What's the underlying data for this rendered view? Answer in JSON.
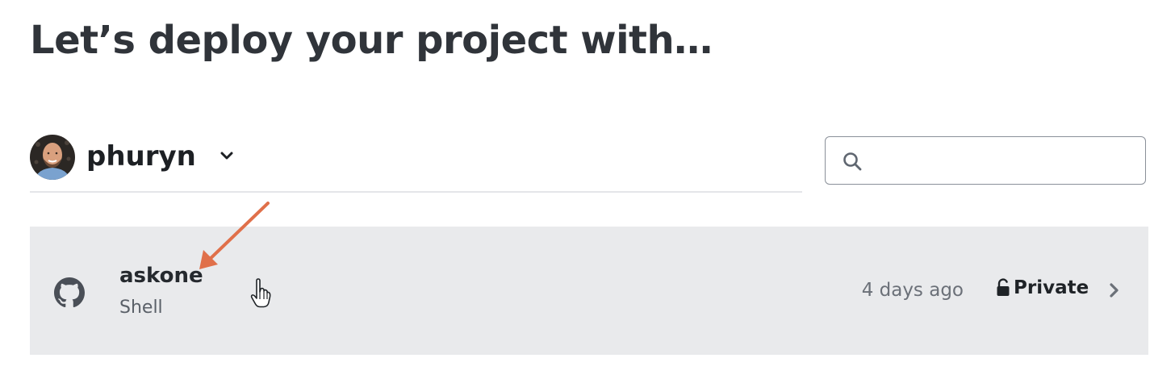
{
  "header": {
    "title": "Let’s deploy your project with…"
  },
  "account": {
    "name": "phuryn",
    "avatar_icon": "user-avatar",
    "dropdown_icon": "chevron-down-icon"
  },
  "search": {
    "placeholder": "",
    "value": "",
    "icon": "search-icon"
  },
  "repositories": [
    {
      "name": "askone",
      "language": "Shell",
      "updated": "4 days ago",
      "visibility": "Private",
      "provider_icon": "github-icon",
      "visibility_icon": "lock-icon",
      "action_icon": "chevron-right-icon"
    }
  ],
  "colors": {
    "row_background": "#e9eaec",
    "annotation_arrow": "#e0704a",
    "title_text": "#30343a"
  }
}
